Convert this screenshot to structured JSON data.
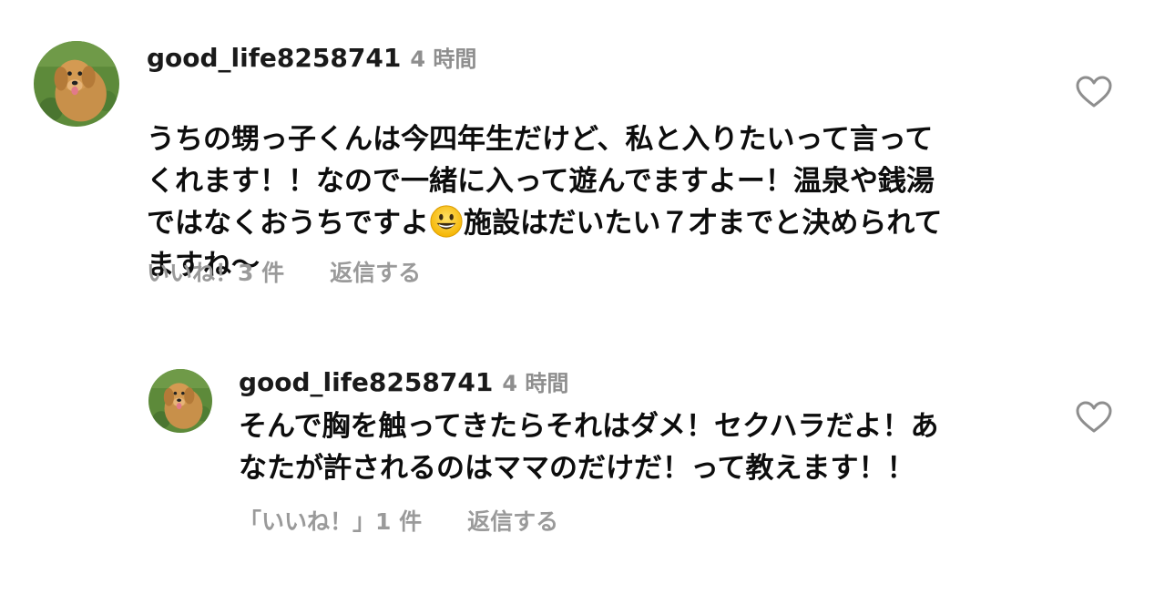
{
  "comments": [
    {
      "username": "good_life8258741",
      "time": "4 時間",
      "text_before_emoji": "うちの甥っ子くんは今四年生だけど、私と入りたいって言って\nくれます！！なので一緒に入って遊んでますよー！温泉や銭湯\nではなくおうちですよ",
      "emoji": "smiling-face-emoji",
      "text_after_emoji": "施設はだいたい７才までと決められて\nますね〜",
      "likes_label": "いいね！3 件",
      "reply_label": "返信する"
    },
    {
      "username": "good_life8258741",
      "time": "4 時間",
      "text": "そんで胸を触ってきたらそれはダメ！セクハラだよ！あ\nなたが許されるのはママのだけだ！って教えます！！",
      "likes_label": "「いいね！」1 件",
      "reply_label": "返信する"
    }
  ],
  "colors": {
    "text": "#0d0d0d",
    "secondary": "#8e8e8e",
    "heart_outline": "#8e8e8e"
  },
  "icons": {
    "like": "heart-outline-icon",
    "avatar": "dog-avatar"
  }
}
